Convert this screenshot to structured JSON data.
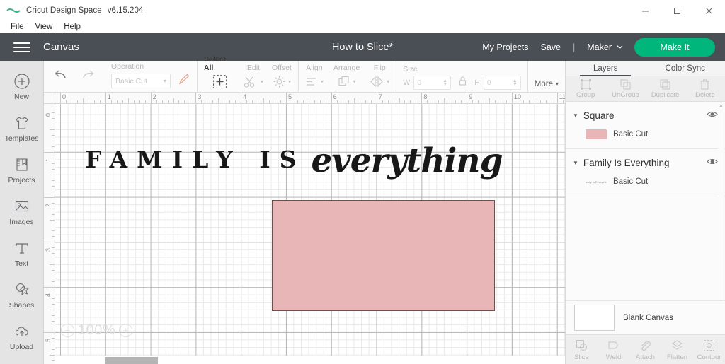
{
  "window": {
    "app_title": "Cricut Design Space",
    "version": "v6.15.204",
    "logo_icon": "cricut-logo-icon",
    "minimize_label": "Minimize",
    "maximize_label": "Maximize",
    "close_label": "Close"
  },
  "menubar": {
    "items": [
      {
        "label": "File"
      },
      {
        "label": "View"
      },
      {
        "label": "Help"
      }
    ]
  },
  "header": {
    "menu_icon": "hamburger-menu-icon",
    "canvas_label": "Canvas",
    "project_title": "How to Slice*",
    "my_projects_label": "My Projects",
    "save_label": "Save",
    "separator": "|",
    "machine_label": "Maker",
    "machine_caret_icon": "chevron-down-icon",
    "make_it_label": "Make It",
    "accent_color": "#00b67a",
    "header_bg": "#4a4f55"
  },
  "sidebar": {
    "items": [
      {
        "label": "New",
        "icon": "plus-circle-icon"
      },
      {
        "label": "Templates",
        "icon": "tshirt-icon"
      },
      {
        "label": "Projects",
        "icon": "book-bookmark-icon"
      },
      {
        "label": "Images",
        "icon": "image-icon"
      },
      {
        "label": "Text",
        "icon": "text-t-icon"
      },
      {
        "label": "Shapes",
        "icon": "shapes-star-icon"
      },
      {
        "label": "Upload",
        "icon": "cloud-upload-icon"
      }
    ]
  },
  "toolbar": {
    "undo_icon": "undo-arrow-icon",
    "redo_icon": "redo-arrow-icon",
    "operation_label": "Operation",
    "operation_value": "Basic Cut",
    "operation_caret": "▾",
    "pencil_icon": "pencil-color-icon",
    "pencil_color": "#e8a08a",
    "select_all_label": "Select All",
    "select_all_icon": "select-all-box-icon",
    "edit_label": "Edit",
    "edit_icon": "scissors-icon",
    "offset_label": "Offset",
    "offset_icon": "offset-sun-icon",
    "align_label": "Align",
    "align_icon": "align-left-icon",
    "arrange_label": "Arrange",
    "arrange_icon": "arrange-layers-icon",
    "flip_label": "Flip",
    "flip_icon": "flip-horizontal-icon",
    "size_label": "Size",
    "lock_icon": "lock-icon",
    "width_label": "W",
    "width_value": "0",
    "height_label": "H",
    "height_value": "0",
    "more_label": "More",
    "more_caret": "▾"
  },
  "canvas": {
    "ruler_h_labels": [
      "0",
      "1",
      "2",
      "3",
      "4",
      "5",
      "6",
      "7",
      "8",
      "9",
      "10",
      "11"
    ],
    "ruler_v_labels": [
      "0",
      "1",
      "2",
      "3",
      "4",
      "5"
    ],
    "artwork_text_part1": "FAMILY IS",
    "artwork_text_part2": "everything",
    "artwork_color": "#181818",
    "rectangle_fill": "#e8b6b6",
    "rectangle_stroke": "#6b5050",
    "zoom_out_icon": "zoom-out-icon",
    "zoom_level": "100%",
    "zoom_in_icon": "zoom-in-icon"
  },
  "right_panel": {
    "tabs": [
      {
        "label": "Layers",
        "active": true
      },
      {
        "label": "Color Sync",
        "active": false
      }
    ],
    "actions": [
      {
        "label": "Group",
        "icon": "group-icon"
      },
      {
        "label": "UnGroup",
        "icon": "ungroup-icon"
      },
      {
        "label": "Duplicate",
        "icon": "duplicate-icon"
      },
      {
        "label": "Delete",
        "icon": "trash-delete-icon"
      }
    ],
    "layers": [
      {
        "name": "Square",
        "caret_icon": "caret-down-icon",
        "visibility_icon": "eye-visible-icon",
        "child_label": "Basic Cut",
        "child_thumb_type": "color-swatch",
        "child_thumb_color": "#e8b6b6"
      },
      {
        "name": "Family Is Everything",
        "caret_icon": "caret-down-icon",
        "visibility_icon": "eye-visible-icon",
        "child_label": "Basic Cut",
        "child_thumb_type": "text-thumbnail",
        "child_thumb_text": "Family Is Everything"
      }
    ],
    "canvas_row": {
      "label": "Blank Canvas",
      "swatch_color": "#ffffff"
    },
    "bottom_actions": [
      {
        "label": "Slice",
        "icon": "slice-icon"
      },
      {
        "label": "Weld",
        "icon": "weld-icon"
      },
      {
        "label": "Attach",
        "icon": "attach-paperclip-icon"
      },
      {
        "label": "Flatten",
        "icon": "flatten-icon"
      },
      {
        "label": "Contour",
        "icon": "contour-icon"
      }
    ]
  }
}
